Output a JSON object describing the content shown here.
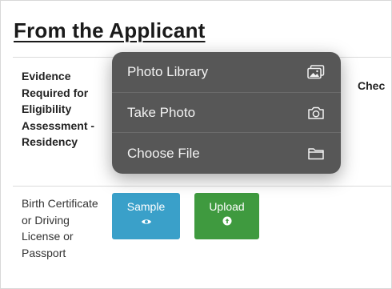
{
  "page": {
    "title": "From the Applicant"
  },
  "table": {
    "header_evidence": "Evidence Required for Eligibility Assessment - Residency",
    "header_check": "Chec",
    "row": {
      "document": "Birth Certificate or Driving License or Passport",
      "sample_label": "Sample",
      "upload_label": "Upload"
    }
  },
  "menu": {
    "items": [
      {
        "label": "Photo Library",
        "icon": "photo-library-icon"
      },
      {
        "label": "Take Photo",
        "icon": "camera-icon"
      },
      {
        "label": "Choose File",
        "icon": "folder-icon"
      }
    ]
  },
  "colors": {
    "sample_button": "#3aa0c9",
    "upload_button": "#3f9a3f",
    "menu_bg": "#525252"
  }
}
